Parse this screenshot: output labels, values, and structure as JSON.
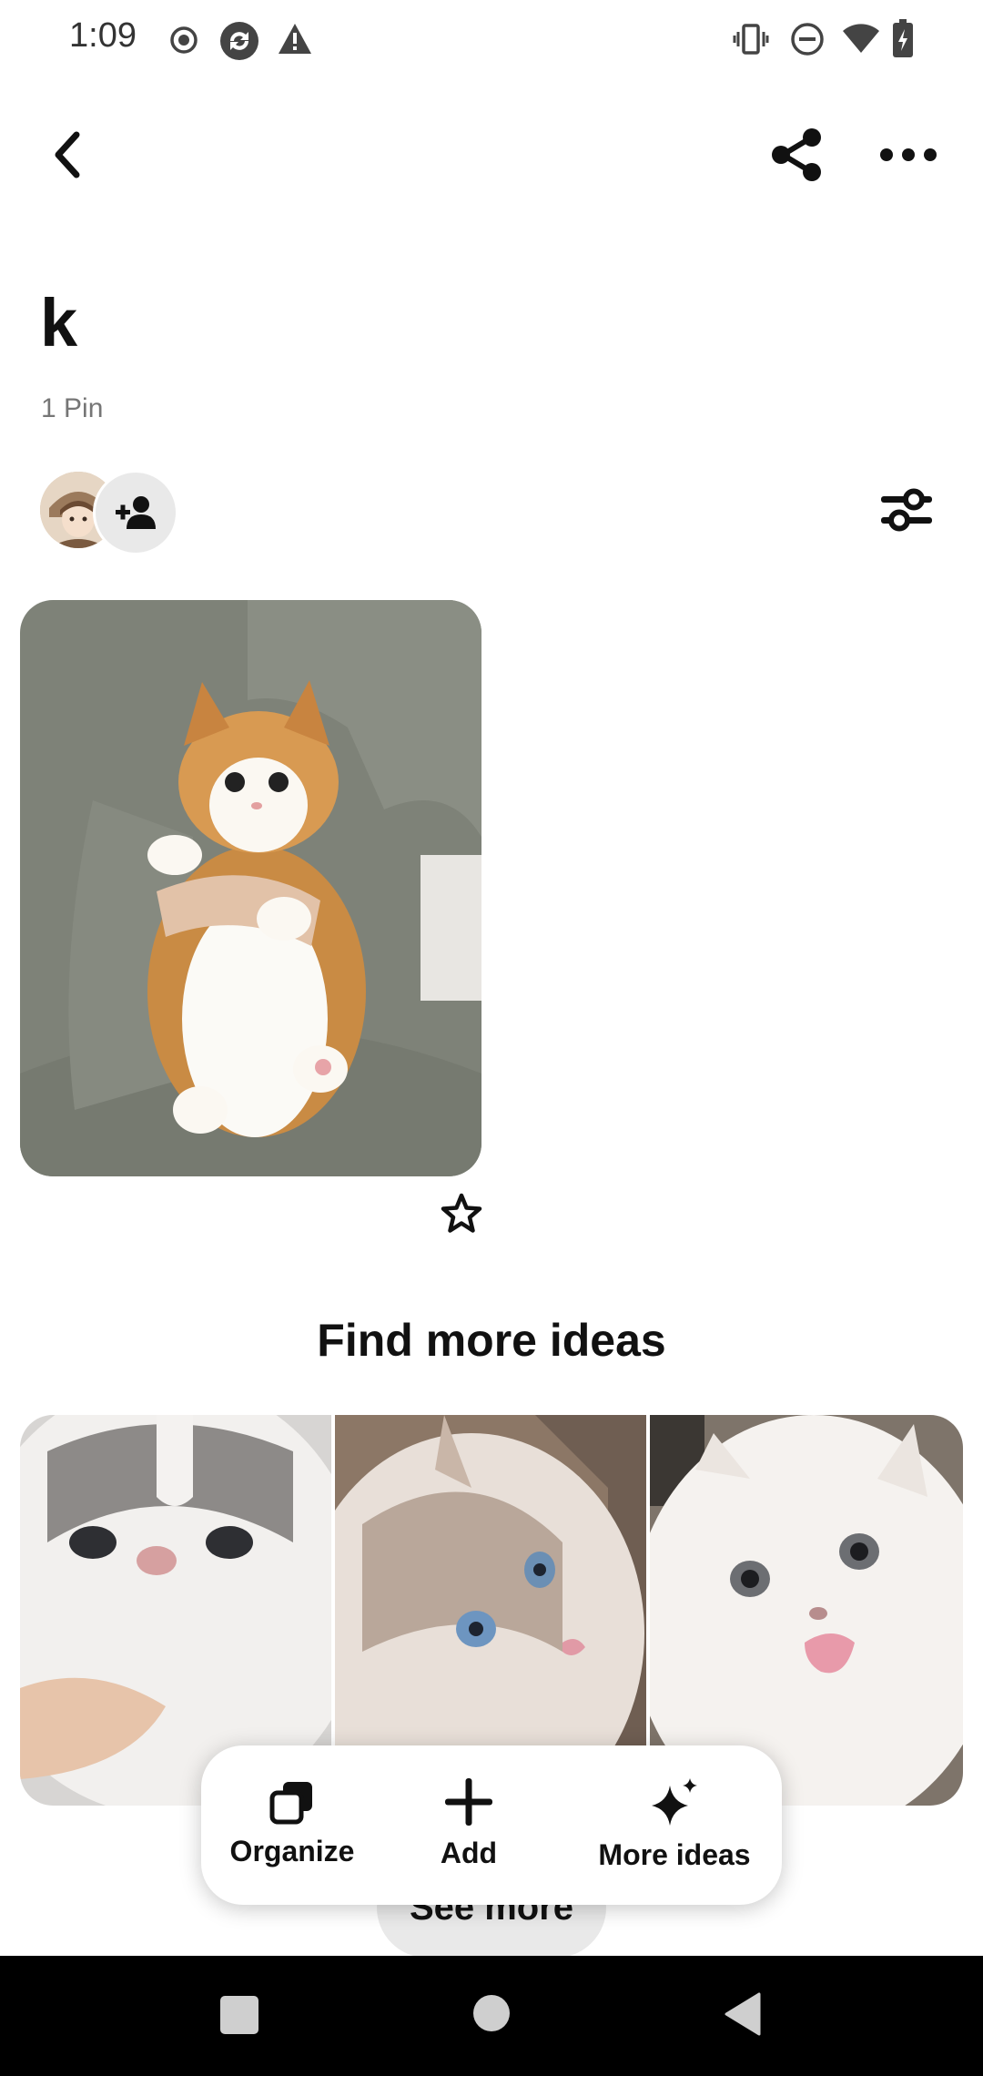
{
  "status_bar": {
    "time": "1:09",
    "left_icons": [
      "record-icon",
      "sync-app-icon",
      "warning-icon"
    ],
    "right_icons": [
      "vibrate-icon",
      "do-not-disturb-icon",
      "wifi-icon",
      "battery-charging-icon"
    ]
  },
  "toolbar": {
    "back_icon": "chevron-left-icon",
    "share_icon": "share-icon",
    "more_icon": "more-horizontal-icon"
  },
  "board": {
    "title": "k",
    "pin_count": "1 Pin"
  },
  "collaborators": {
    "avatar_icon": "avatar",
    "add_collaborator_icon": "add-person-icon",
    "filter_icon": "filter-sliders-icon"
  },
  "pins": [
    {
      "image": "cat-orange-white-held",
      "favorite_icon": "star-outline-icon"
    }
  ],
  "ideas_section": {
    "title": "Find more ideas",
    "images": [
      "cat-ragdoll-closeup",
      "cat-blue-eyes-lying",
      "cat-white-persian-tongue"
    ],
    "see_more": "See more"
  },
  "action_bar": {
    "items": [
      {
        "label": "Organize",
        "icon": "organize-icon"
      },
      {
        "label": "Add",
        "icon": "plus-icon"
      },
      {
        "label": "More ideas",
        "icon": "sparkle-icon"
      }
    ]
  },
  "nav_bar": {
    "icons": [
      "recents-square-icon",
      "home-circle-icon",
      "back-triangle-icon"
    ]
  },
  "colors": {
    "text_primary": "#111111",
    "text_secondary": "#767676",
    "chip_background": "#e9e9e9",
    "nav_background": "#000000"
  }
}
